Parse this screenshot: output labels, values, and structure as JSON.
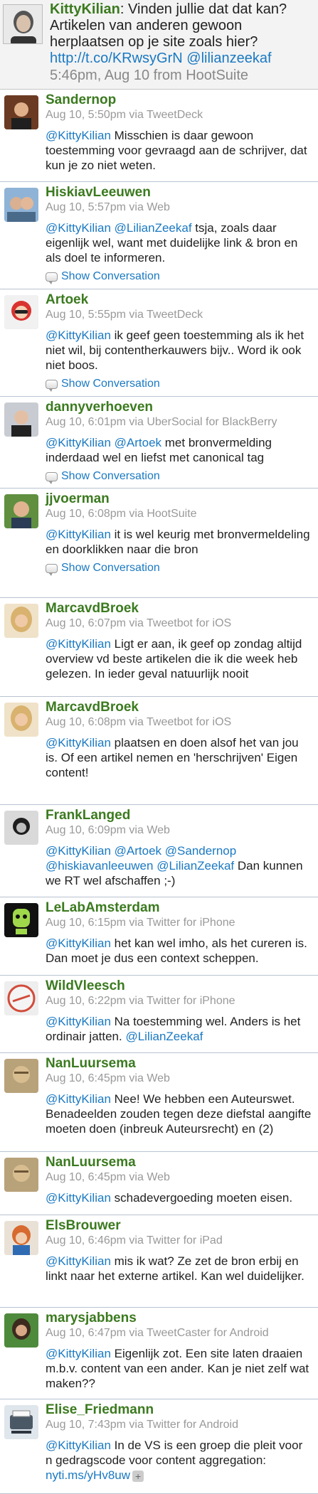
{
  "header": {
    "username": "KittyKilian",
    "text": ": Vinden jullie dat dat kan? Artikelen van anderen gewoon herplaatsen op je site zoals hier? ",
    "link": "http://t.co/KRwsyGrN",
    "mention": "@lilianzeekaf",
    "meta": "5:46pm, Aug 10 from HootSuite"
  },
  "show_conversation": "Show Conversation",
  "tweets": [
    {
      "name": "Sandernop",
      "meta": "Aug 10, 5:50pm via TweetDeck",
      "m1": "@KittyKilian",
      "t1": " Misschien is daar gewoon toestemming voor gevraagd aan de schrijver, dat kun je zo niet weten.",
      "avatar_color": "#8a4b2c"
    },
    {
      "name": "HiskiavLeeuwen",
      "meta": "Aug 10, 5:57pm via Web",
      "m1": "@KittyKilian",
      "m2": "@LilianZeekaf",
      "t1": " ",
      "t2": " tsja, zoals daar eigenlijk wel, want met duidelijke link & bron en als doel te informeren.",
      "avatar_color": "#7aa3c8"
    },
    {
      "name": "Artoek",
      "meta": "Aug 10, 5:55pm via TweetDeck",
      "m1": "@KittyKilian",
      "t1": " ik geef geen toestemming als ik het niet wil, bij contentherkauwers bijv.. Word ik ook niet boos.",
      "avatar_color": "#d9322f"
    },
    {
      "name": "dannyverhoeven",
      "meta": "Aug 10, 6:01pm via UberSocial for BlackBerry",
      "m1": "@KittyKilian",
      "m2": "@Artoek",
      "t1": " ",
      "t2": " met bronvermelding inderdaad wel en liefst met canonical tag",
      "avatar_color": "#6b7b8c"
    },
    {
      "name": "jjvoerman",
      "meta": "Aug 10, 6:08pm via HootSuite",
      "m1": "@KittyKilian",
      "t1": " it is wel keurig met bronvermeldeling en doorklikken naar die bron",
      "avatar_color": "#4c7a3a"
    },
    {
      "name": "MarcavdBroek",
      "meta": "Aug 10, 6:07pm via Tweetbot for iOS",
      "m1": "@KittyKilian",
      "t1": " Ligt er aan, ik geef op zondag altijd overview vd beste artikelen die ik die week heb gelezen. In ieder geval natuurlijk nooit",
      "avatar_color": "#c9a26b"
    },
    {
      "name": "MarcavdBroek",
      "meta": "Aug 10, 6:08pm via Tweetbot for iOS",
      "m1": "@KittyKilian",
      "t1": " plaatsen en doen alsof het van jou is. Of een artikel nemen en 'herschrijven' Eigen content!",
      "avatar_color": "#c9a26b"
    },
    {
      "name": "FrankLanged",
      "meta": "Aug 10, 6:09pm via Web",
      "m1": "@KittyKilian",
      "m2": "@Artoek",
      "m3": "@Sandernop",
      "m4": "@hiskiavanleeuwen",
      "m5": "@LilianZeekaf",
      "t1": " ",
      "t2": " ",
      "t3": " ",
      "t4": " ",
      "t5": " Dan kunnen we RT wel afschaffen ;-)",
      "avatar_color": "#3a3a3a"
    },
    {
      "name": "LeLabAmsterdam",
      "meta": "Aug 10, 6:15pm via Twitter for iPhone",
      "m1": "@KittyKilian",
      "t1": " het kan wel imho, als het cureren is. Dan moet je dus een context scheppen.",
      "avatar_color": "#2d2d2d"
    },
    {
      "name": "WildVleesch",
      "meta": "Aug 10, 6:22pm via Twitter for iPhone",
      "m1": "@KittyKilian",
      "t1": " Na toestemming wel. Anders is het ordinair jatten. ",
      "m2": "@LilianZeekaf",
      "avatar_color": "#e6e6e6"
    },
    {
      "name": "NanLuursema",
      "meta": "Aug 10, 6:45pm via Web",
      "m1": "@KittyKilian",
      "t1": " Nee! We hebben een Auteurswet. Benadeelden zouden tegen deze diefstal aangifte moeten doen (inbreuk Auteursrecht) en (2)",
      "avatar_color": "#b39a6e"
    },
    {
      "name": "NanLuursema",
      "meta": "Aug 10, 6:45pm via Web",
      "m1": "@KittyKilian",
      "t1": " schadevergoeding moeten eisen.",
      "avatar_color": "#b39a6e"
    },
    {
      "name": "ElsBrouwer",
      "meta": "Aug 10, 6:46pm via Twitter for iPad",
      "m1": "@KittyKilian",
      "t1": " mis ik wat? Ze zet de bron erbij en linkt naar het externe artikel. Kan wel duidelijker.",
      "avatar_color": "#d07a3a"
    },
    {
      "name": "marysjabbens",
      "meta": "Aug 10, 6:47pm via TweetCaster for Android",
      "m1": "@KittyKilian",
      "t1": " Eigenlijk zot. Een site laten draaien m.b.v. content van een ander. Kan je niet zelf wat maken??",
      "avatar_color": "#5a4030"
    },
    {
      "name": "Elise_Friedmann",
      "meta": "Aug 10, 7:43pm via Twitter for Android",
      "m1": "@KittyKilian",
      "t1": " In de VS is een groep die pleit voor n gedragscode voor content aggregation: ",
      "link": "nyti.ms/yHv8uw",
      "avatar_color": "#8fa0b0"
    }
  ]
}
